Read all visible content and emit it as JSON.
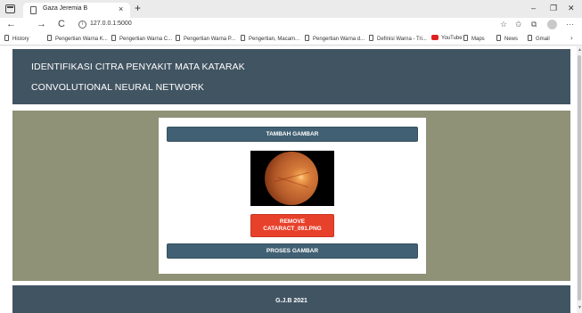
{
  "browser": {
    "tab_title": "Gaza Jeremia B",
    "tab_close": "×",
    "new_tab": "+",
    "url": "127.0.0.1:5000",
    "nav": {
      "back": "←",
      "forward": "→",
      "reload": "C"
    },
    "window": {
      "minimize": "–",
      "restore": "❐",
      "close": "✕"
    },
    "toolbar": {
      "read_aloud": "☆",
      "favorites": "✩",
      "collections": "⧉",
      "menu": "···"
    },
    "bookmarks": [
      {
        "label": "History"
      },
      {
        "label": "Pengertian Warna K..."
      },
      {
        "label": "Pengertian Warna C..."
      },
      {
        "label": "Pengertian Warna P..."
      },
      {
        "label": "Pengertian, Macam..."
      },
      {
        "label": "Pengertian Warna d..."
      },
      {
        "label": "Definisi Warna - Tri..."
      },
      {
        "label": "YouTube"
      },
      {
        "label": "Maps"
      },
      {
        "label": "News"
      },
      {
        "label": "Gmail"
      }
    ],
    "bookmarks_more": "›"
  },
  "page": {
    "header": {
      "title": "IDENTIFIKASI CITRA PENYAKIT MATA KATARAK",
      "subtitle": "CONVOLUTIONAL NEURAL NETWORK"
    },
    "buttons": {
      "add_image": "TAMBAH GAMBAR",
      "remove_line1": "REMOVE",
      "remove_line2": "CATARACT_091.PNG",
      "process_image": "PROSES GAMBAR"
    },
    "footer": {
      "text": "G.J.B 2021"
    }
  },
  "colors": {
    "header_bg": "#415462",
    "content_bg": "#8f9277",
    "button_bg": "#416073",
    "remove_bg": "#e8412b"
  }
}
